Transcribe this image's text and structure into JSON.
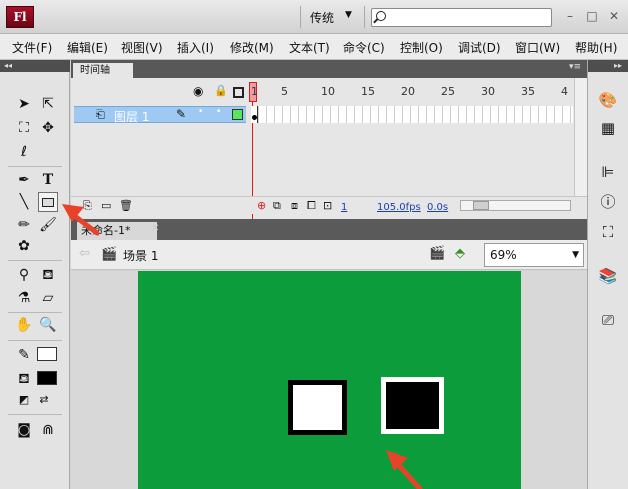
{
  "app": {
    "logo": "Fl",
    "workspace": "传统",
    "search_placeholder": ""
  },
  "window_controls": {
    "minimize": "–",
    "restore": "□",
    "close": "✕"
  },
  "menu": [
    "文件(F)",
    "编辑(E)",
    "视图(V)",
    "插入(I)",
    "修改(M)",
    "文本(T)",
    "命令(C)",
    "控制(O)",
    "调试(D)",
    "窗口(W)",
    "帮助(H)"
  ],
  "timeline": {
    "tab_label": "时间轴",
    "layer_name": "图层 1",
    "frame_numbers": [
      "1",
      "5",
      "10",
      "15",
      "20",
      "25",
      "30",
      "35",
      "4"
    ],
    "current_frame": "1",
    "fps": "105.0fps",
    "time": "0.0s"
  },
  "document": {
    "tab_label": "未命名-1*",
    "scene_label": "场景 1",
    "zoom": "69%"
  },
  "stage": {
    "background_color": "#0d9c3b"
  },
  "annotation": {
    "arrow_color": "#e8432a"
  }
}
